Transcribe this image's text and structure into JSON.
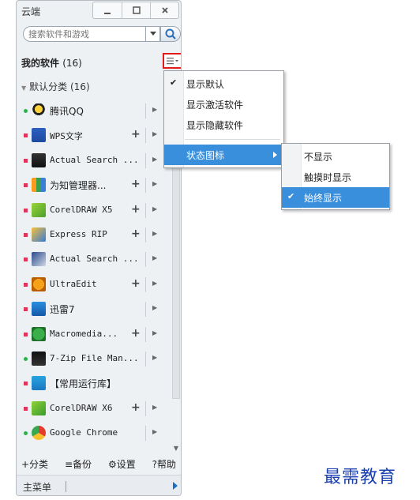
{
  "window": {
    "title": "云端"
  },
  "search": {
    "placeholder": "搜索软件和游戏"
  },
  "my_software": {
    "label": "我的软件",
    "count": "(16)"
  },
  "category": {
    "label": "默认分类",
    "count": "(16)"
  },
  "apps": [
    {
      "name": "腾讯QQ",
      "status": "green",
      "icon": "qq-icon",
      "plus": false,
      "cn": true
    },
    {
      "name": "WPS文字",
      "status": "red",
      "icon": "wps-icon",
      "plus": true,
      "cn": false
    },
    {
      "name": "Actual Search ...",
      "status": "red",
      "icon": "binoculars-icon",
      "plus": false,
      "cn": false
    },
    {
      "name": "为知管理器...",
      "status": "red",
      "icon": "wiz-icon",
      "plus": true,
      "cn": true
    },
    {
      "name": "CorelDRAW X5",
      "status": "red",
      "icon": "coreldraw-icon",
      "plus": true,
      "cn": false
    },
    {
      "name": "Express RIP",
      "status": "red",
      "icon": "express-rip-icon",
      "plus": true,
      "cn": false
    },
    {
      "name": "Actual Search ...",
      "status": "red",
      "icon": "actual-search-icon",
      "plus": false,
      "cn": false
    },
    {
      "name": "UltraEdit",
      "status": "red",
      "icon": "ultraedit-icon",
      "plus": true,
      "cn": false
    },
    {
      "name": "迅雷7",
      "status": "red",
      "icon": "thunder-icon",
      "plus": false,
      "cn": true
    },
    {
      "name": "Macromedia...",
      "status": "red",
      "icon": "macromedia-icon",
      "plus": true,
      "cn": false
    },
    {
      "name": "7-Zip File Man...",
      "status": "green",
      "icon": "7zip-icon",
      "plus": false,
      "cn": false
    },
    {
      "name": "【常用运行库】",
      "status": "red",
      "icon": "runtime-icon",
      "plus": false,
      "cn": true,
      "noarrow": true
    },
    {
      "name": "CorelDRAW X6",
      "status": "red",
      "icon": "coreldraw-x6-icon",
      "plus": true,
      "cn": false
    },
    {
      "name": "Google Chrome",
      "status": "green",
      "icon": "chrome-icon",
      "plus": false,
      "cn": false
    }
  ],
  "toolbar": {
    "add_category": "+分类",
    "backup": "≡备份",
    "settings": "⚙设置",
    "help": "?帮助"
  },
  "statusbar": {
    "label": "主菜单"
  },
  "menu": {
    "items": [
      {
        "label": "显示默认",
        "checked": true
      },
      {
        "label": "显示激活软件",
        "checked": false
      },
      {
        "label": "显示隐藏软件",
        "checked": false
      },
      {
        "label": "状态图标",
        "checked": false,
        "submenu": true,
        "highlighted": true
      }
    ]
  },
  "submenu": {
    "items": [
      {
        "label": "不显示",
        "checked": false
      },
      {
        "label": "触摸时显示",
        "checked": false
      },
      {
        "label": "始终显示",
        "checked": true,
        "highlighted": true
      }
    ]
  },
  "watermark": "最需教育",
  "colors": {
    "green": "#2bb34a",
    "red": "#e2335a",
    "highlight": "#3a8fdd",
    "accent_red": "#e21c1c"
  }
}
